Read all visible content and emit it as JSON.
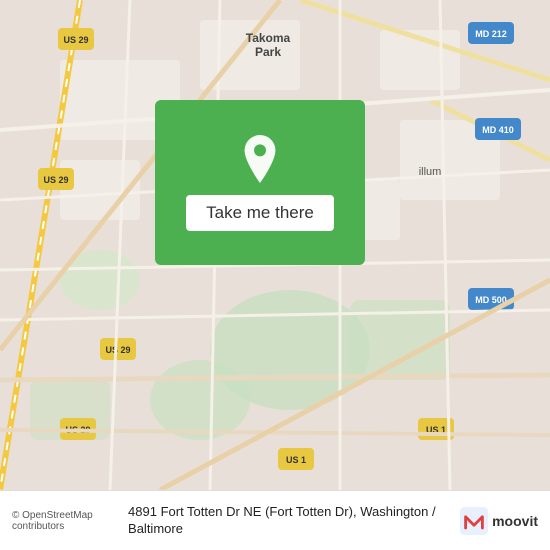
{
  "map": {
    "alt": "Map of Washington / Baltimore area showing Fort Totten Dr NE"
  },
  "overlay": {
    "pin_icon": "location-pin",
    "button_label": "Take me there"
  },
  "bottom_bar": {
    "osm_credit": "© OpenStreetMap contributors",
    "address": "4891 Fort Totten Dr NE (Fort Totten Dr), Washington / Baltimore",
    "moovit_label": "moovit"
  }
}
